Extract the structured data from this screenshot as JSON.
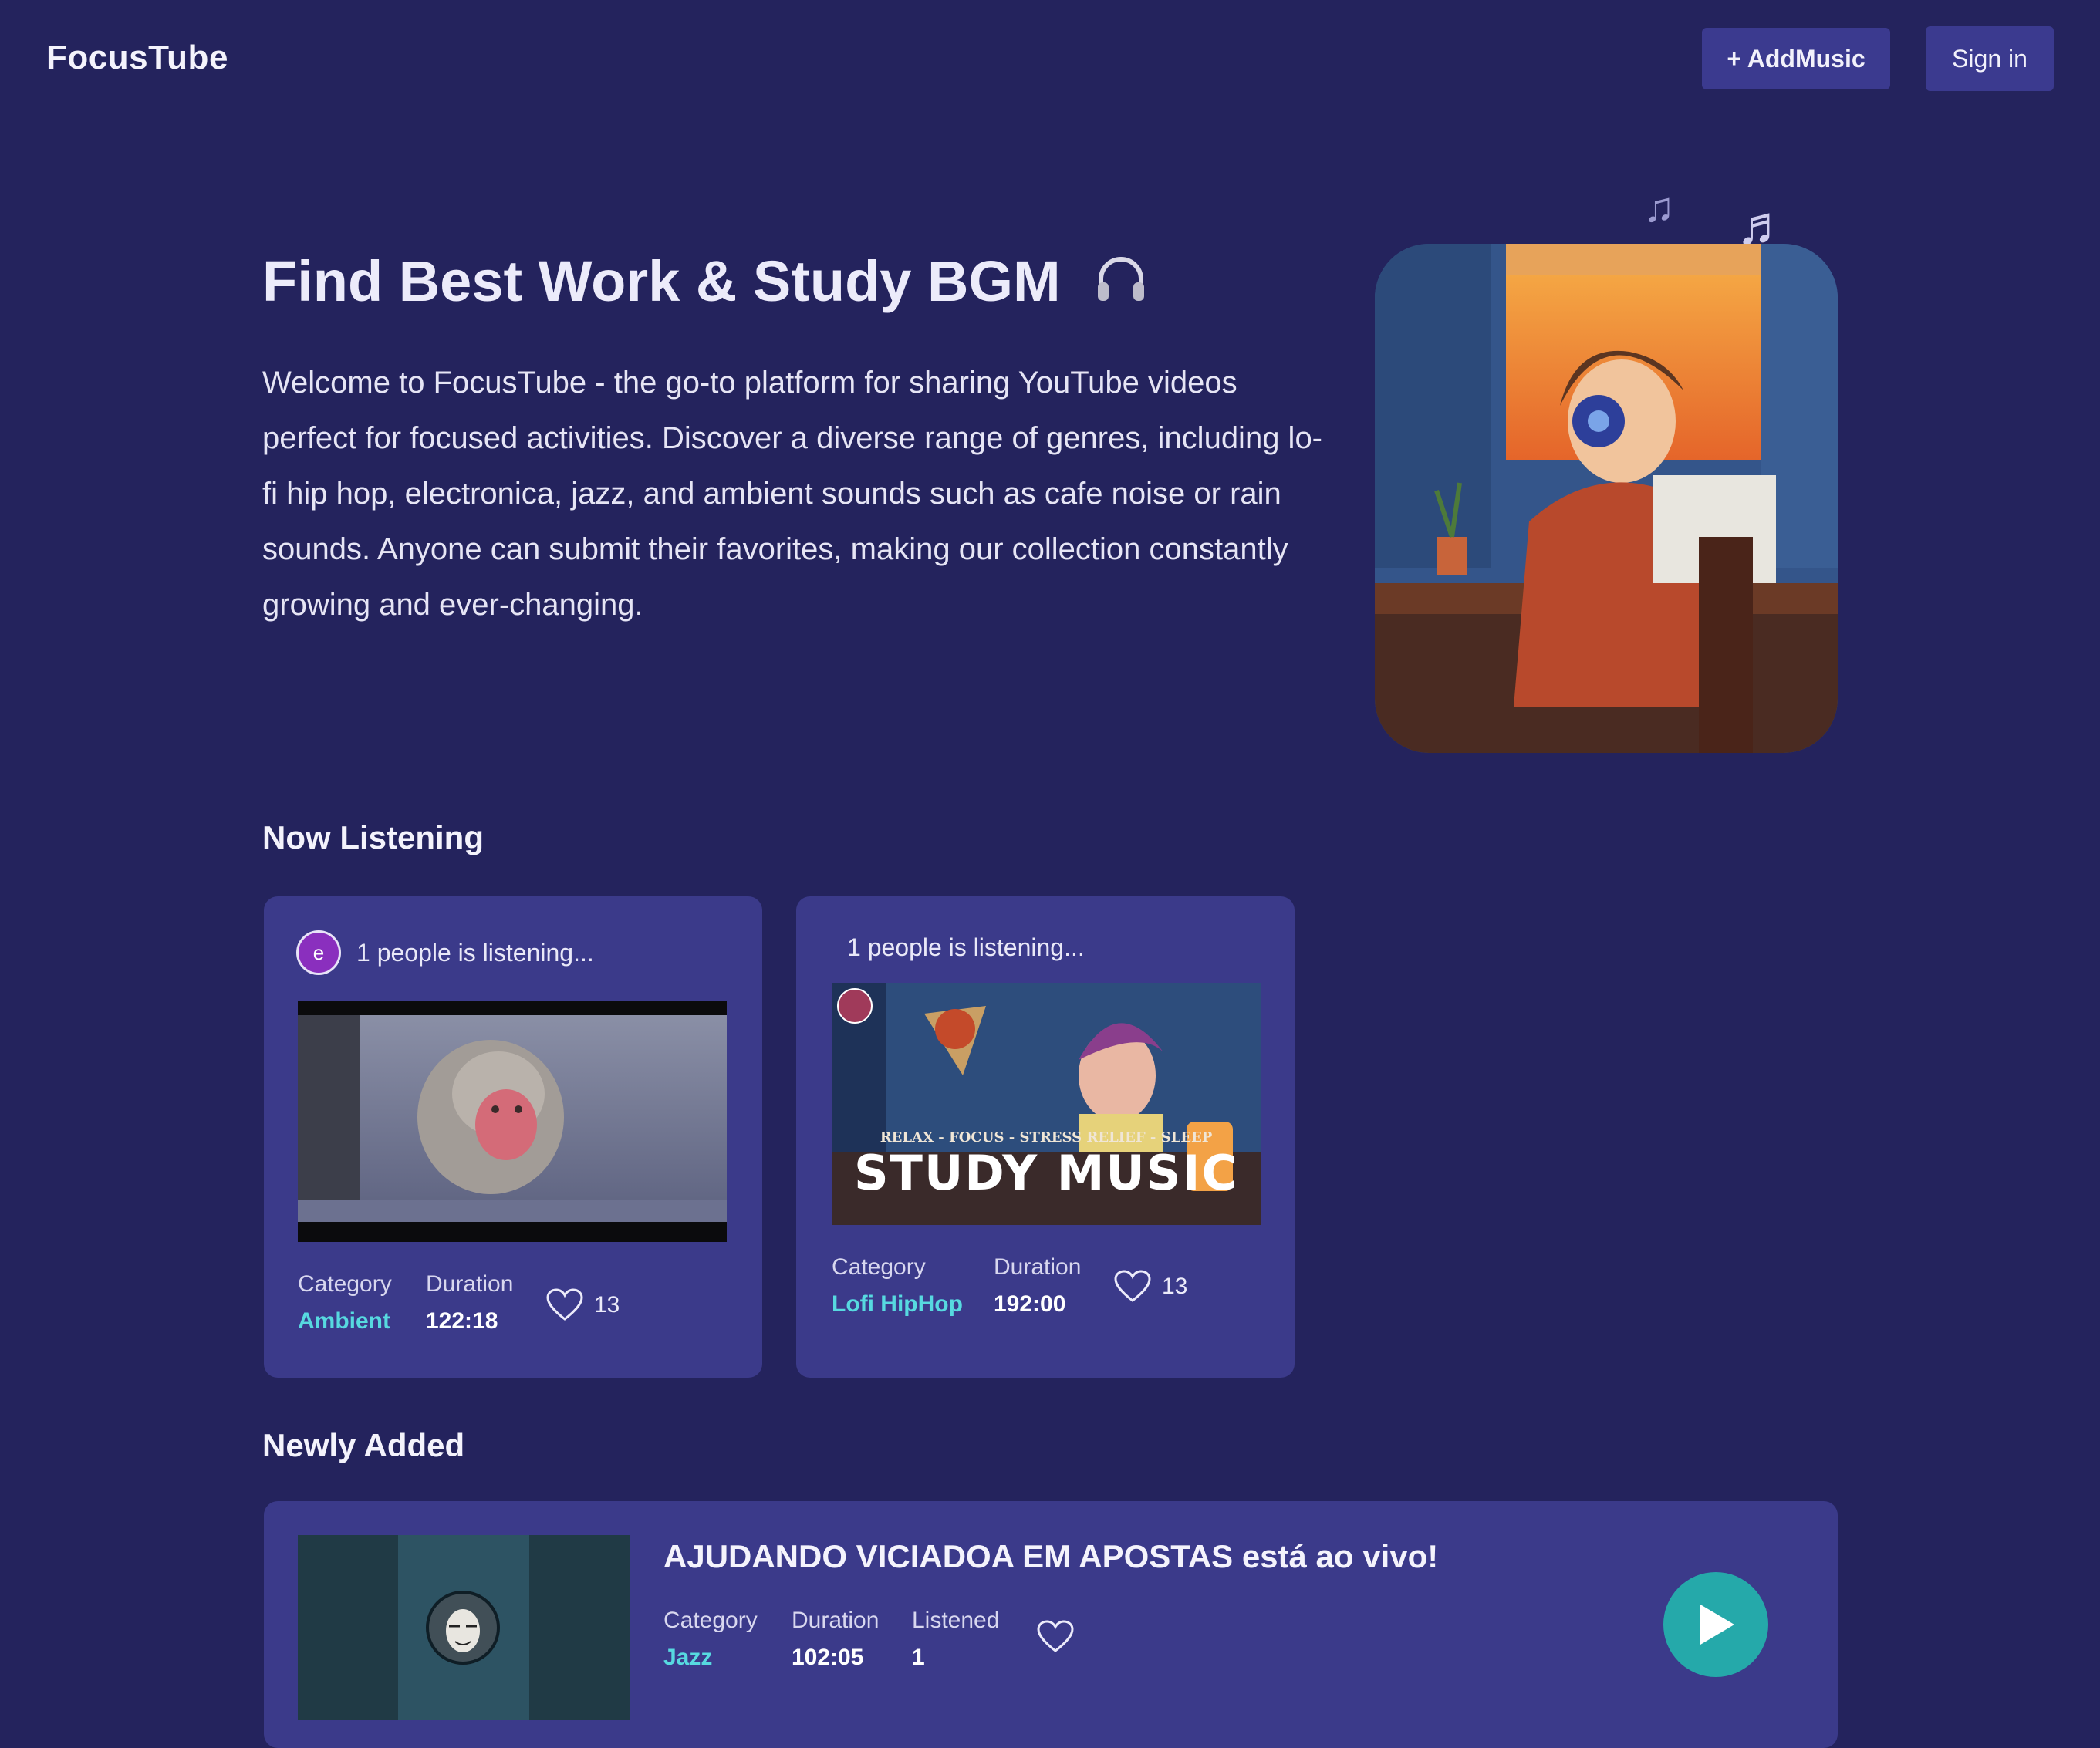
{
  "header": {
    "logo": "FocusTube",
    "add_music_label": "+ AddMusic",
    "sign_in_label": "Sign in"
  },
  "hero": {
    "title": "Find Best Work & Study BGM",
    "description": "Welcome to FocusTube - the go-to platform for sharing YouTube videos perfect for focused activities. Discover a diverse range of genres, including lo-fi hip hop, electronica, jazz, and ambient sounds such as cafe noise or rain sounds. Anyone can submit their favorites, making our collection constantly growing and ever-changing.",
    "icon": "headphones-icon"
  },
  "now_listening": {
    "title": "Now Listening",
    "cards": [
      {
        "avatar_letter": "e",
        "listening_text": "1 people is listening...",
        "category_label": "Category",
        "category": "Ambient",
        "duration_label": "Duration",
        "duration": "122:18",
        "likes": "13"
      },
      {
        "listening_text": "1 people is listening...",
        "thumb_subtitle": "RELAX - FOCUS - STRESS RELIEF - SLEEP",
        "thumb_title": "STUDY MUSIC",
        "category_label": "Category",
        "category": "Lofi HipHop",
        "duration_label": "Duration",
        "duration": "192:00",
        "likes": "13"
      }
    ]
  },
  "newly_added": {
    "title": "Newly Added",
    "items": [
      {
        "title": "AJUDANDO VICIADOA EM APOSTAS está ao vivo!",
        "category_label": "Category",
        "category": "Jazz",
        "duration_label": "Duration",
        "duration": "102:05",
        "listened_label": "Listened",
        "listened": "1"
      }
    ]
  },
  "colors": {
    "background": "#24235d",
    "card": "#3b3a8a",
    "accent": "#57d9e0",
    "play": "#25a9aa"
  }
}
